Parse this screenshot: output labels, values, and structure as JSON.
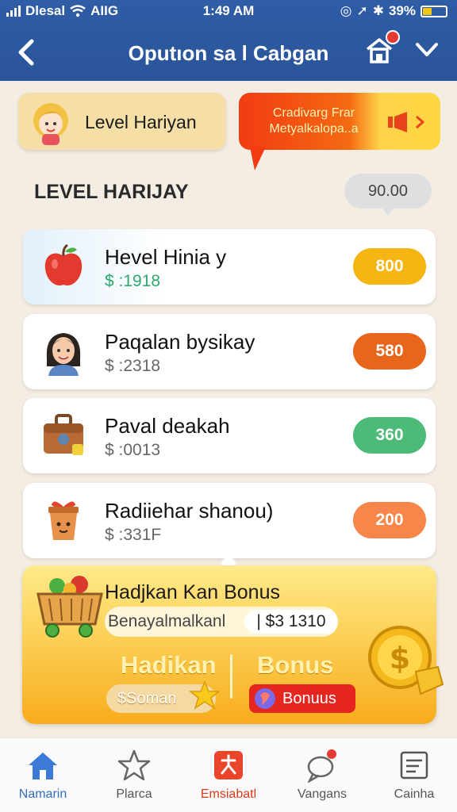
{
  "status": {
    "carrier": "Dlesal",
    "network": "AIIG",
    "time": "1:49 AM",
    "battery": "39%"
  },
  "header": {
    "title": "Oputıon sa l Cabgan",
    "back_icon": "chevron-left-icon",
    "home_icon": "home-cart-icon",
    "menu_icon": "chevron-down-icon"
  },
  "banners": {
    "left_label": "Level Hariyan",
    "right_promo": "Cradivarg Frar Metyalkalopa..a"
  },
  "section": {
    "title": "LEVEL HARIJAY",
    "value": "90.00"
  },
  "levels": [
    {
      "name": "Hevel Hinia y",
      "amount": "$ :1918",
      "badge": "800",
      "badge_color": "#f5b513",
      "icon": "apple-icon"
    },
    {
      "name": "Paqalan bysikay",
      "amount": "$ :2318",
      "badge": "580",
      "badge_color": "#e8661c",
      "icon": "woman-avatar-icon"
    },
    {
      "name": "Paval deakah",
      "amount": "$ :0013",
      "badge": "360",
      "badge_color": "#4dbb78",
      "icon": "bag-icon"
    },
    {
      "name": "Radiiehar shanou)",
      "amount": "$ :331F",
      "badge": "200",
      "badge_color": "#f7864a",
      "icon": "gift-pot-icon"
    }
  ],
  "bonus": {
    "title": "Hadjkan Kan Bonus",
    "subtitle": "Benayalmalkanl",
    "amount": "| $3 1310",
    "left_heading": "Hadikan",
    "right_heading": "Bonus",
    "left_button": "$Soman",
    "right_button": "Bonuus"
  },
  "nav": [
    {
      "label": "Namarin",
      "icon": "home-icon"
    },
    {
      "label": "Plarca",
      "icon": "star-icon"
    },
    {
      "label": "Emsiabatl",
      "icon": "activity-icon"
    },
    {
      "label": "Vangans",
      "icon": "chat-icon"
    },
    {
      "label": "Cainha",
      "icon": "document-icon"
    }
  ]
}
